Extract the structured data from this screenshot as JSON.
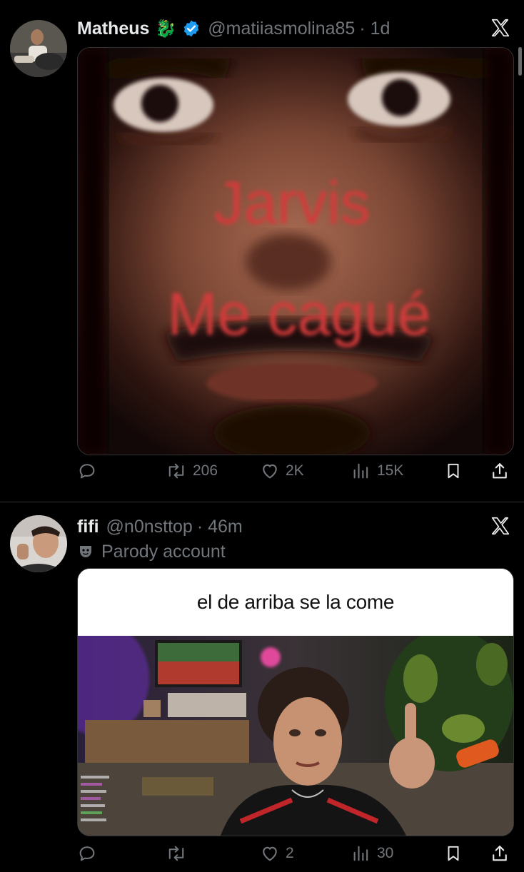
{
  "tweets": [
    {
      "name": "Matheus",
      "emoji": "🐉",
      "handle": "@matiiasmolina85",
      "time": "· 1d",
      "meme_line1": "Jarvis",
      "meme_line2": "Me cagué",
      "stats": {
        "retweets": "206",
        "likes": "2K",
        "views": "15K"
      }
    },
    {
      "name": "fifi",
      "handle": "@n0nsttop",
      "time": "· 46m",
      "label": "Parody account",
      "caption": "el de arriba se la come",
      "stats": {
        "likes": "2",
        "views": "30"
      }
    }
  ],
  "colors": {
    "bg": "#000000",
    "text": "#e7e9ea",
    "muted": "#71767b",
    "verified": "#1d9bf0",
    "meme_red": "#d33a3a"
  }
}
